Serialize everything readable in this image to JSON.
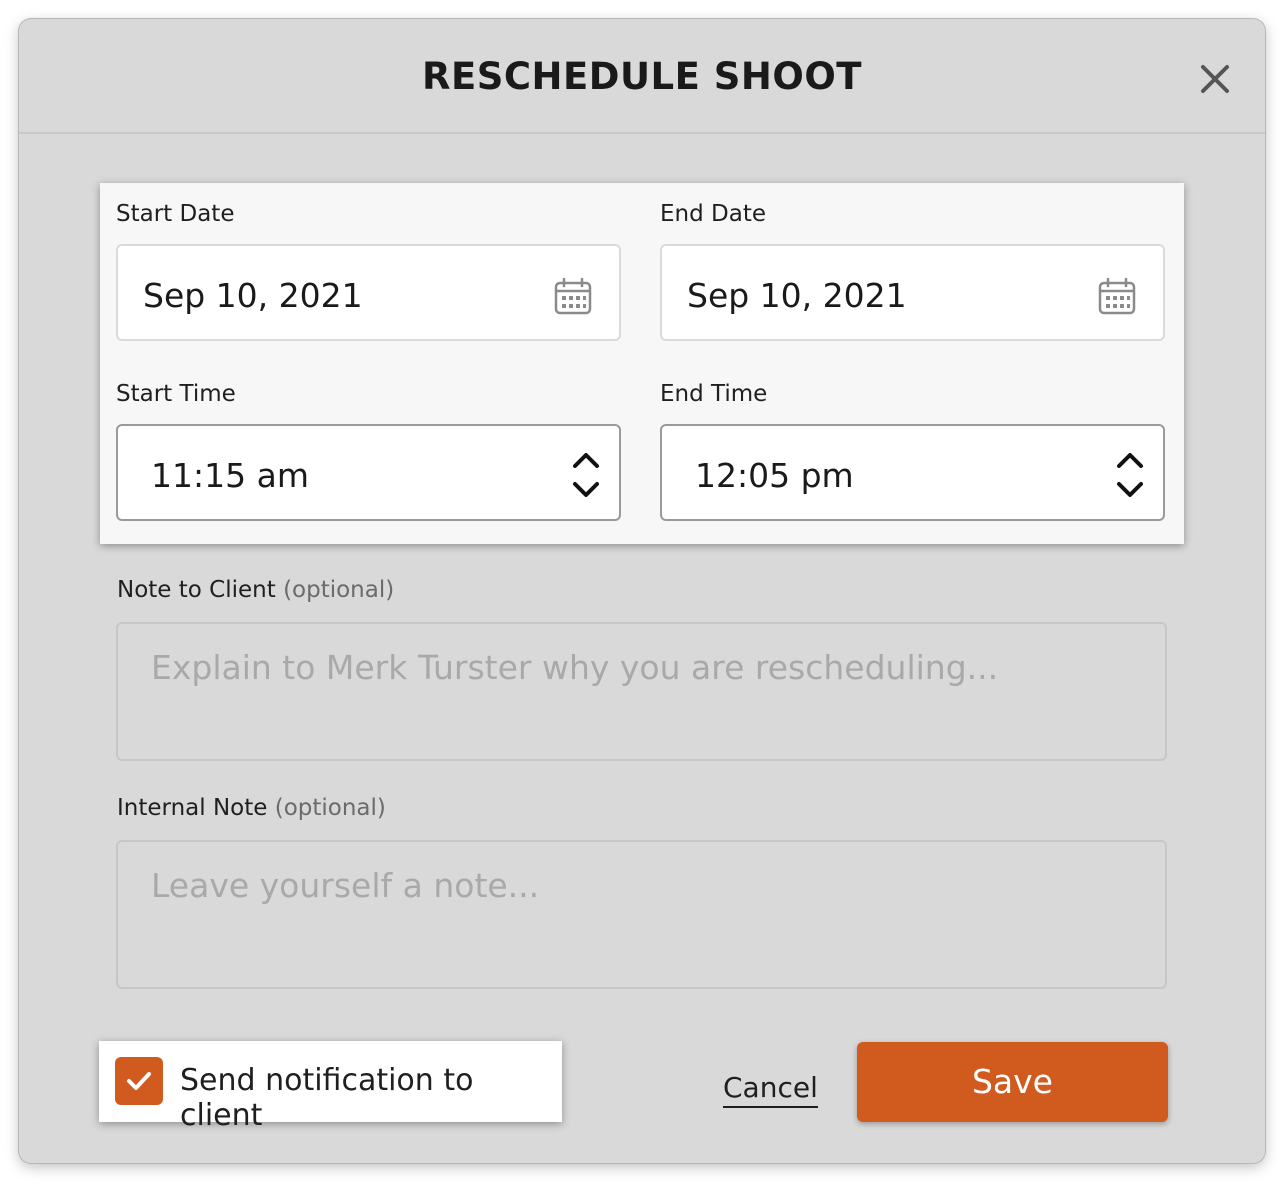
{
  "dialog": {
    "title": "RESCHEDULE SHOOT",
    "close_icon": "close-icon"
  },
  "schedule": {
    "start_date": {
      "label": "Start Date",
      "value": "Sep 10, 2021",
      "icon": "calendar-icon"
    },
    "end_date": {
      "label": "End Date",
      "value": "Sep 10, 2021",
      "icon": "calendar-icon"
    },
    "start_time": {
      "label": "Start Time",
      "value": "11:15 am",
      "icon": "up-down-stepper-icon"
    },
    "end_time": {
      "label": "End Time",
      "value": "12:05 pm",
      "icon": "up-down-stepper-icon"
    }
  },
  "note_to_client": {
    "label": "Note to Client",
    "optional": "(optional)",
    "placeholder": "Explain to Merk Turster why you are rescheduling..."
  },
  "internal_note": {
    "label": "Internal Note",
    "optional": "(optional)",
    "placeholder": "Leave yourself a note..."
  },
  "footer": {
    "notify_label": "Send notification to client",
    "notify_checked": true,
    "cancel_label": "Cancel",
    "save_label": "Save"
  },
  "colors": {
    "accent": "#d15a1f",
    "overlay_bg": "#d9d9d9",
    "panel_bg": "#f7f7f7"
  }
}
